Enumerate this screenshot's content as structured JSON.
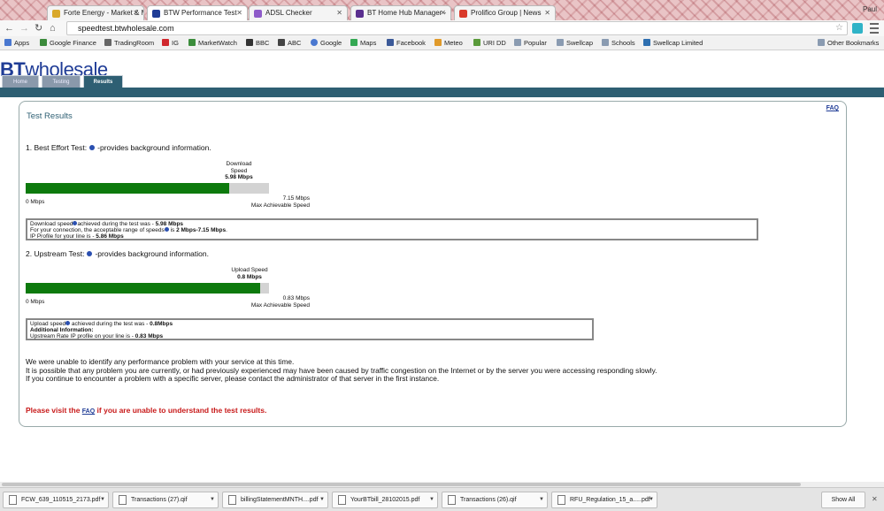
{
  "browser": {
    "tabs": [
      {
        "title": "Forte Energy - Market & M",
        "color": "#d9a82a"
      },
      {
        "title": "BTW Performance Test",
        "color": "#1f3c96"
      },
      {
        "title": "ADSL Checker",
        "color": "#8e5bc9"
      },
      {
        "title": "BT Home Hub Manager - ",
        "color": "#5a2f8f"
      },
      {
        "title": "Prolifico Group | News",
        "color": "#d93a2a"
      }
    ],
    "close_glyph": "✕",
    "user": "Paul",
    "url": "speedtest.btwholesale.com",
    "bookmarks": [
      {
        "label": "Apps",
        "icon": "apps-grid-icon",
        "color": "#4a78d0"
      },
      {
        "label": "Google Finance",
        "icon": "google-finance-icon",
        "color": "#3b8a3b"
      },
      {
        "label": "TradingRoom",
        "icon": "tradingroom-icon",
        "color": "#666"
      },
      {
        "label": "IG",
        "icon": "ig-icon",
        "color": "#d0282e"
      },
      {
        "label": "MarketWatch",
        "icon": "marketwatch-icon",
        "color": "#3c8d3c"
      },
      {
        "label": "BBC",
        "icon": "bbc-icon",
        "color": "#333"
      },
      {
        "label": "ABC",
        "icon": "abc-icon",
        "color": "#444"
      },
      {
        "label": "Google",
        "icon": "google-icon",
        "color": "#4a78d0"
      },
      {
        "label": "Maps",
        "icon": "maps-icon",
        "color": "#34a853"
      },
      {
        "label": "Facebook",
        "icon": "facebook-icon",
        "color": "#3b5998"
      },
      {
        "label": "Meteo",
        "icon": "meteo-icon",
        "color": "#e09a2a"
      },
      {
        "label": "URI DD",
        "icon": "uri-icon",
        "color": "#5a9a3a"
      },
      {
        "label": "Popular",
        "icon": "folder-icon",
        "color": "#8a9bb1"
      },
      {
        "label": "Swellcap",
        "icon": "folder-icon",
        "color": "#8a9bb1"
      },
      {
        "label": "Schools",
        "icon": "folder-icon",
        "color": "#8a9bb1"
      },
      {
        "label": "Swellcap Limited",
        "icon": "swellcap-icon",
        "color": "#2e6fb0"
      },
      {
        "label": "Other Bookmarks",
        "icon": "folder-icon",
        "color": "#8a9bb1"
      }
    ]
  },
  "site": {
    "logo_bold": "BT",
    "logo_rest": "wholesale",
    "nav": [
      "Home",
      "Testing",
      "Results"
    ],
    "faq": "FAQ",
    "title": "Test Results"
  },
  "download": {
    "heading": "1. Best Effort Test:",
    "heading_suffix": "-provides background information.",
    "label_line1": "Download",
    "label_line2": "Speed",
    "value": "5.98 Mbps",
    "fraction": 0.8364,
    "min_label": "0 Mbps",
    "max_value": "7.15 Mbps",
    "max_label": "Max Achievable Speed",
    "box_line1_a": "Download speed",
    "box_line1_b": "achieved during the test was - ",
    "box_line1_c": "5.98 Mbps",
    "box_line2_a": "For your connection, the acceptable range of speeds",
    "box_line2_b": " is ",
    "box_line2_c": "2 Mbps-7.15 Mbps",
    "box_line2_d": ".",
    "box_line3_a": "IP Profile for your line is - ",
    "box_line3_b": "5.86 Mbps"
  },
  "upload": {
    "heading": "2. Upstream Test:",
    "heading_suffix": "-provides background information.",
    "label": "Upload Speed",
    "value": "0.8 Mbps",
    "fraction": 0.9639,
    "min_label": "0 Mbps",
    "max_value": "0.83 Mbps",
    "max_label": "Max Achievable Speed",
    "box_line1_a": "Upload speed",
    "box_line1_b": " achieved during the test was - ",
    "box_line1_c": "0.8Mbps",
    "box_line2": "Additional Information:",
    "box_line3_a": "Upstream Rate IP profile on your line is - ",
    "box_line3_b": "0.83 Mbps"
  },
  "message": {
    "line1": "We were unable to identify any performance problem with your service at this time.",
    "line2": "It is possible that any problem you are currently, or had previously experienced may have been caused by traffic congestion on the Internet or by the server you were accessing responding slowly.",
    "line3": "If you continue to encounter a problem with a specific server, please contact the administrator of that server in the first instance.",
    "visit_a": "Please visit the ",
    "visit_link": "FAQ",
    "visit_b": " if you are unable to understand the test results."
  },
  "downloads": {
    "files": [
      "FCW_639_110515_2173.pdf",
      "Transactions (27).qif",
      "billingStatementMNTH....pdf",
      "YourBTbill_28102015.pdf",
      "Transactions (26).qif",
      "RFU_Regulation_15_a.....pdf"
    ],
    "show_all": "Show All",
    "close": "✕"
  }
}
